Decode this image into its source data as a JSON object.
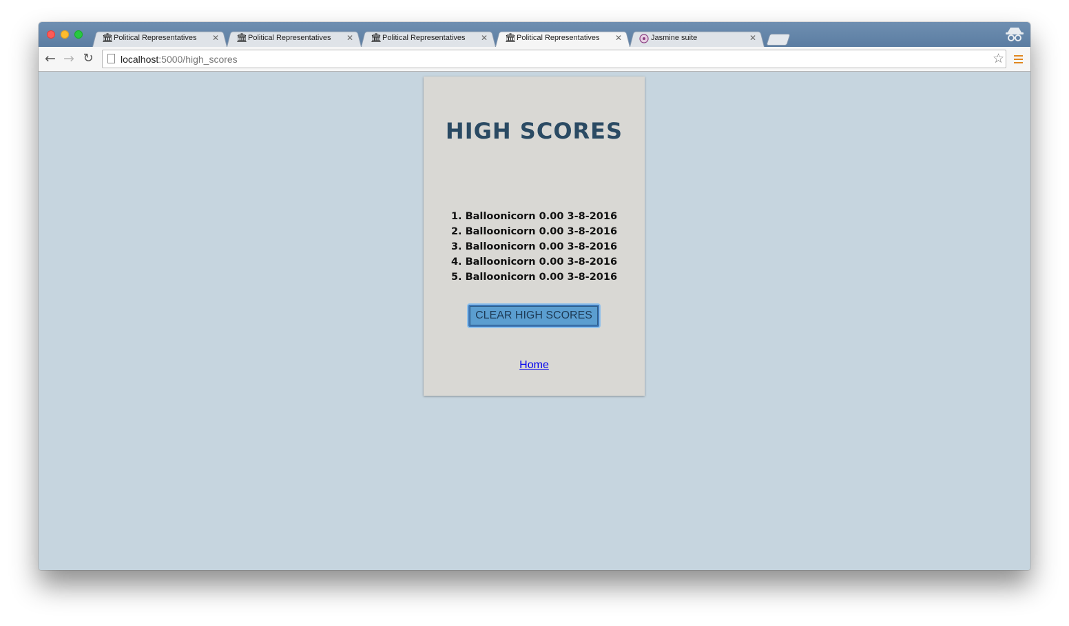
{
  "browser": {
    "tabs": [
      {
        "title": "Political Representatives",
        "favicon": "building-icon",
        "active": false
      },
      {
        "title": "Political Representatives",
        "favicon": "building-icon",
        "active": false
      },
      {
        "title": "Political Representatives",
        "favicon": "building-icon",
        "active": false
      },
      {
        "title": "Political Representatives",
        "favicon": "building-icon",
        "active": true
      },
      {
        "title": "Jasmine suite",
        "favicon": "jasmine-flower-icon",
        "active": false
      }
    ],
    "address": {
      "host": "localhost",
      "path": ":5000/high_scores"
    },
    "menu_color": "#e0861f"
  },
  "page": {
    "title": "HIGH SCORES",
    "scores": [
      "1. Balloonicorn 0.00 3-8-2016",
      "2. Balloonicorn 0.00 3-8-2016",
      "3. Balloonicorn 0.00 3-8-2016",
      "4. Balloonicorn 0.00 3-8-2016",
      "5. Balloonicorn 0.00 3-8-2016"
    ],
    "clear_button_label": "CLEAR HIGH SCORES",
    "home_link_label": "Home"
  }
}
